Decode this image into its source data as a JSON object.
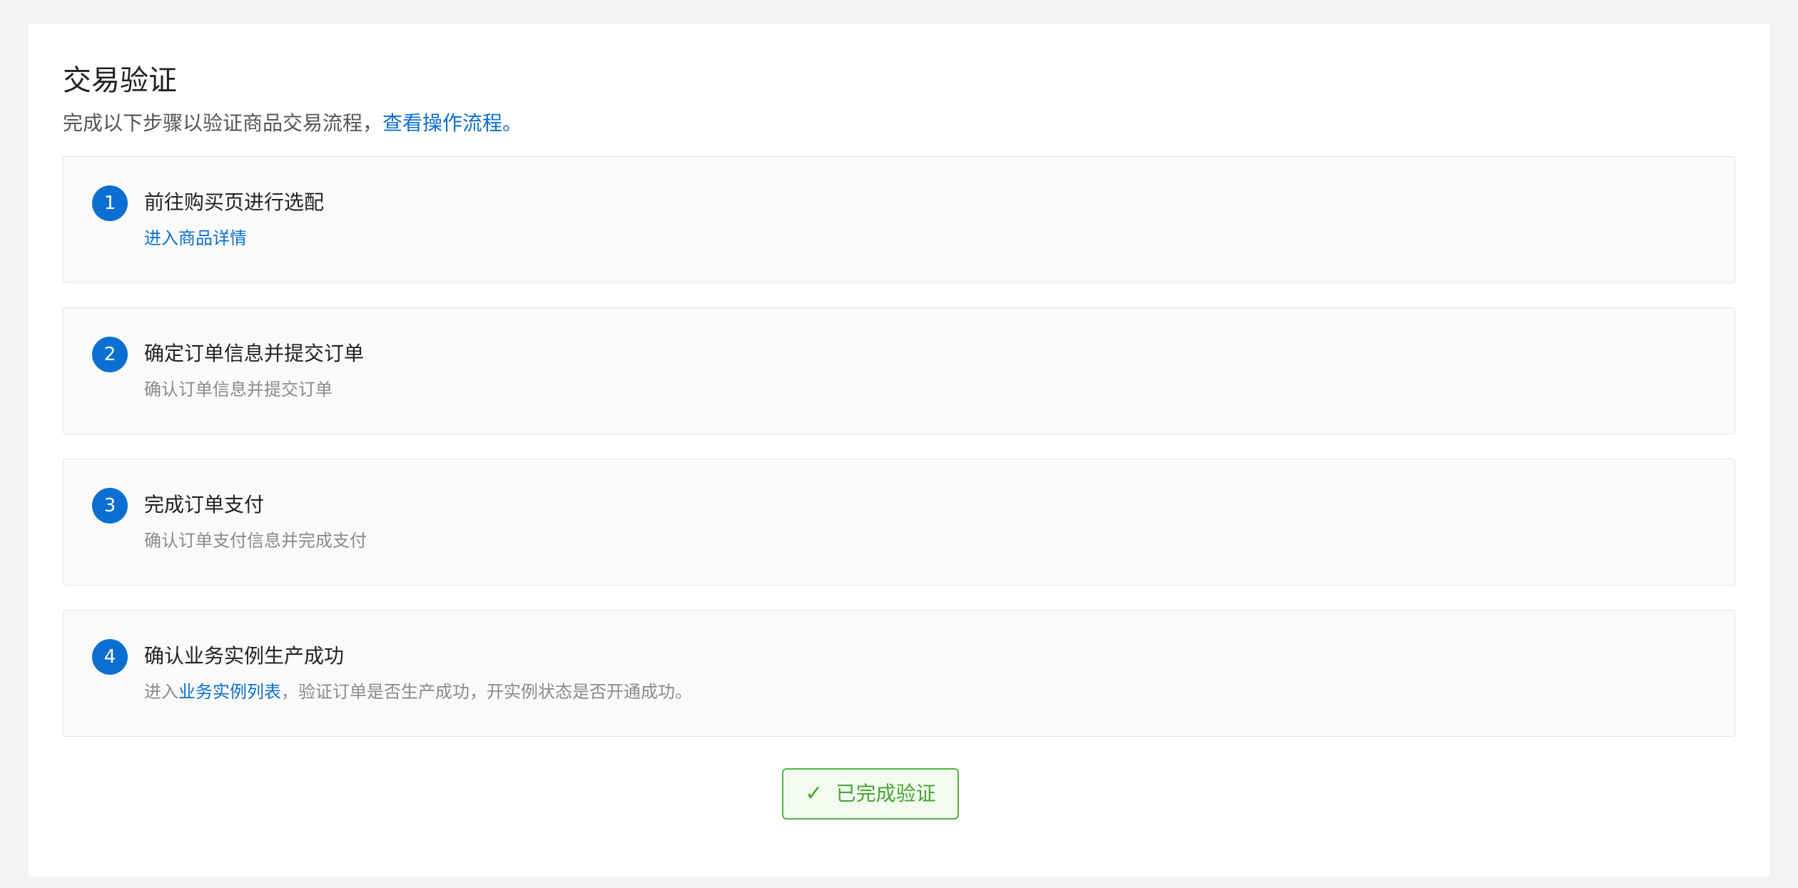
{
  "header": {
    "title": "交易验证",
    "subtitle_text": "完成以下步骤以验证商品交易流程，",
    "subtitle_link": "查看操作流程。"
  },
  "steps": [
    {
      "number": "1",
      "title": "前往购买页进行选配",
      "desc_link": "进入商品详情"
    },
    {
      "number": "2",
      "title": "确定订单信息并提交订单",
      "desc": "确认订单信息并提交订单"
    },
    {
      "number": "3",
      "title": "完成订单支付",
      "desc": "确认订单支付信息并完成支付"
    },
    {
      "number": "4",
      "title": "确认业务实例生产成功",
      "desc_prefix": "进入",
      "desc_link": "业务实例列表",
      "desc_suffix": "，验证订单是否生产成功，开实例状态是否开通成功。"
    }
  ],
  "actions": {
    "done_label": "已完成验证",
    "done_icon": "check-icon"
  },
  "colors": {
    "accent": "#0b6fd1",
    "success": "#56b441",
    "success_bg": "#f3faf0"
  }
}
